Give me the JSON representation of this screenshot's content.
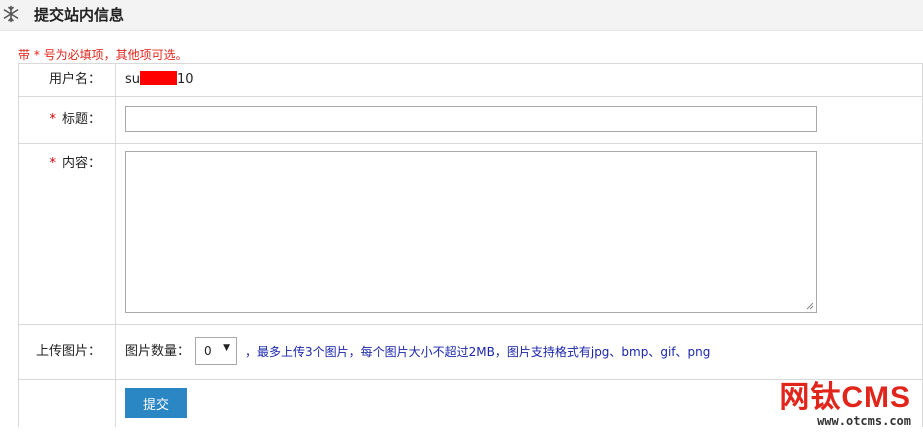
{
  "header": {
    "title": "提交站内信息",
    "icon": "snowflake-icon"
  },
  "notice": "带 * 号为必填项，其他项可选。",
  "form": {
    "username": {
      "label": "用户名：",
      "value_prefix": "su",
      "value_suffix": "10"
    },
    "title_field": {
      "required_mark": "*",
      "label": "标题：",
      "value": ""
    },
    "content_field": {
      "required_mark": "*",
      "label": "内容：",
      "value": ""
    },
    "upload": {
      "label": "上传图片：",
      "count_label": "图片数量：",
      "count_selected": "0",
      "hint": "，最多上传3个图片，每个图片大小不超过2MB，图片支持格式有jpg、bmp、gif、png"
    },
    "submit_label": "提交"
  },
  "watermark": {
    "brand": "网钛CMS",
    "url": "www.otcms.com"
  },
  "colors": {
    "notice": "#e1251b",
    "hint": "#1a26a8",
    "submit_bg": "#2b86c4",
    "brand": "#e1251b"
  }
}
